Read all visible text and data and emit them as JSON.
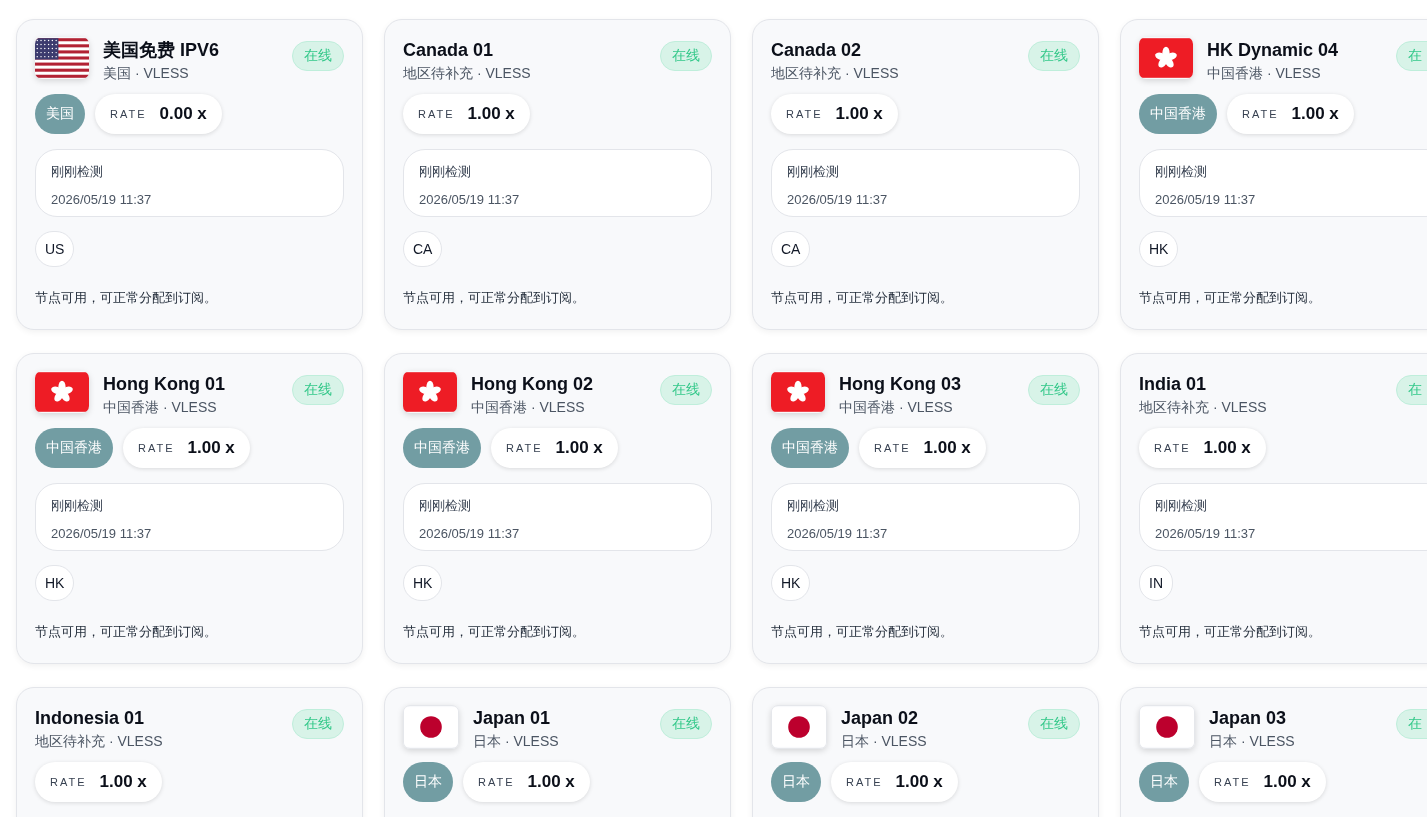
{
  "nodes": [
    {
      "name": "美国免费 IPV6",
      "flag": {
        "kind": "us"
      },
      "subtitle": "美国 · VLESS",
      "status": "在线",
      "region_tag": "美国",
      "rate_label": "RATE",
      "rate": "0.00 x",
      "check_label": "刚刚检测",
      "check_time": "2026/05/19 11:37",
      "code": "US",
      "note": "节点可用，可正常分配到订阅。"
    },
    {
      "name": "Canada 01",
      "subtitle": "地区待补充 · VLESS",
      "status": "在线",
      "rate_label": "RATE",
      "rate": "1.00 x",
      "check_label": "刚刚检测",
      "check_time": "2026/05/19 11:37",
      "code": "CA",
      "note": "节点可用，可正常分配到订阅。"
    },
    {
      "name": "Canada 02",
      "subtitle": "地区待补充 · VLESS",
      "status": "在线",
      "rate_label": "RATE",
      "rate": "1.00 x",
      "check_label": "刚刚检测",
      "check_time": "2026/05/19 11:37",
      "code": "CA",
      "note": "节点可用，可正常分配到订阅。"
    },
    {
      "name": "HK Dynamic 04",
      "flag": {
        "kind": "hk"
      },
      "subtitle": "中国香港 · VLESS",
      "status": "在",
      "region_tag": "中国香港",
      "rate_label": "RATE",
      "rate": "1.00 x",
      "check_label": "刚刚检测",
      "check_time": "2026/05/19 11:37",
      "code": "HK",
      "note": "节点可用，可正常分配到订阅。"
    },
    {
      "name": "Hong Kong 01",
      "flag": {
        "kind": "hk"
      },
      "subtitle": "中国香港 · VLESS",
      "status": "在线",
      "region_tag": "中国香港",
      "rate_label": "RATE",
      "rate": "1.00 x",
      "check_label": "刚刚检测",
      "check_time": "2026/05/19 11:37",
      "code": "HK",
      "note": "节点可用，可正常分配到订阅。"
    },
    {
      "name": "Hong Kong 02",
      "flag": {
        "kind": "hk"
      },
      "subtitle": "中国香港 · VLESS",
      "status": "在线",
      "region_tag": "中国香港",
      "rate_label": "RATE",
      "rate": "1.00 x",
      "check_label": "刚刚检测",
      "check_time": "2026/05/19 11:37",
      "code": "HK",
      "note": "节点可用，可正常分配到订阅。"
    },
    {
      "name": "Hong Kong 03",
      "flag": {
        "kind": "hk"
      },
      "subtitle": "中国香港 · VLESS",
      "status": "在线",
      "region_tag": "中国香港",
      "rate_label": "RATE",
      "rate": "1.00 x",
      "check_label": "刚刚检测",
      "check_time": "2026/05/19 11:37",
      "code": "HK",
      "note": "节点可用，可正常分配到订阅。"
    },
    {
      "name": "India 01",
      "subtitle": "地区待补充 · VLESS",
      "status": "在",
      "rate_label": "RATE",
      "rate": "1.00 x",
      "check_label": "刚刚检测",
      "check_time": "2026/05/19 11:37",
      "code": "IN",
      "note": "节点可用，可正常分配到订阅。"
    },
    {
      "name": "Indonesia 01",
      "subtitle": "地区待补充 · VLESS",
      "status": "在线",
      "rate_label": "RATE",
      "rate": "1.00 x"
    },
    {
      "name": "Japan 01",
      "flag": {
        "kind": "jp"
      },
      "subtitle": "日本 · VLESS",
      "status": "在线",
      "region_tag": "日本",
      "rate_label": "RATE",
      "rate": "1.00 x"
    },
    {
      "name": "Japan 02",
      "flag": {
        "kind": "jp"
      },
      "subtitle": "日本 · VLESS",
      "status": "在线",
      "region_tag": "日本",
      "rate_label": "RATE",
      "rate": "1.00 x"
    },
    {
      "name": "Japan 03",
      "flag": {
        "kind": "jp"
      },
      "subtitle": "日本 · VLESS",
      "status": "在",
      "region_tag": "日本",
      "rate_label": "RATE",
      "rate": "1.00 x"
    }
  ]
}
